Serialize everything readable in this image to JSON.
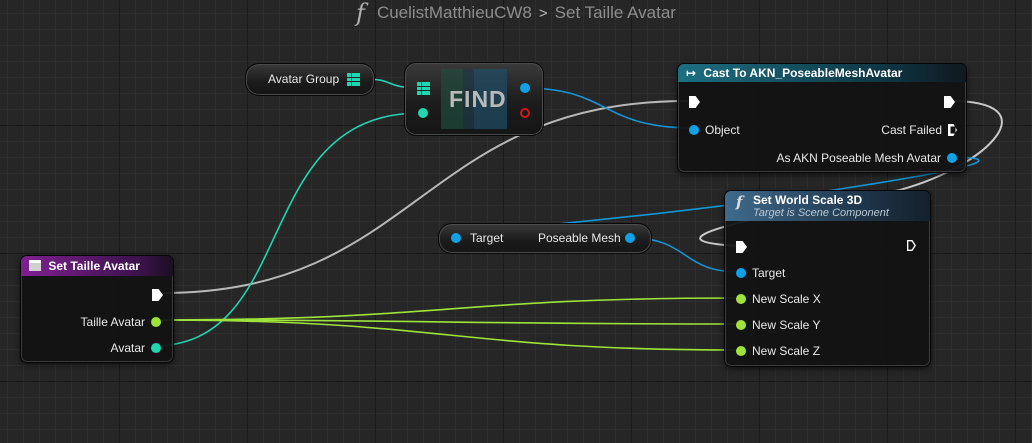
{
  "breadcrumb": {
    "function_icon": "f",
    "graph_name": "CuelistMatthieuCW8",
    "separator": ">",
    "function_name": "Set Taille Avatar"
  },
  "nodes": {
    "avatar_group": {
      "label": "Avatar Group",
      "icon": "grid-icon"
    },
    "find": {
      "label": "FIND"
    },
    "cast": {
      "title": "Cast To AKN_PoseableMeshAvatar",
      "icon": "cast-arrow-icon",
      "pin_object": "Object",
      "pin_cast_failed": "Cast Failed",
      "pin_as": "As AKN Poseable Mesh Avatar"
    },
    "getter": {
      "pin_target": "Target",
      "pin_output": "Poseable Mesh"
    },
    "set_world_scale": {
      "title": "Set World Scale 3D",
      "subtitle": "Target is Scene Component",
      "icon": "f",
      "pin_target": "Target",
      "pin_x": "New Scale X",
      "pin_y": "New Scale Y",
      "pin_z": "New Scale Z"
    },
    "entry": {
      "title": "Set Taille Avatar",
      "icon": "function-entry-icon",
      "pin_taille": "Taille Avatar",
      "pin_avatar": "Avatar"
    }
  },
  "colors": {
    "exec": "#ffffff",
    "object": "#0fa1e8",
    "float": "#9fe33a",
    "struct": "#1ed6b0",
    "cast_header": "#186a7c",
    "function_header": "#3a5d80",
    "entry_header": "#7b1f8c",
    "error": "#d11818"
  }
}
